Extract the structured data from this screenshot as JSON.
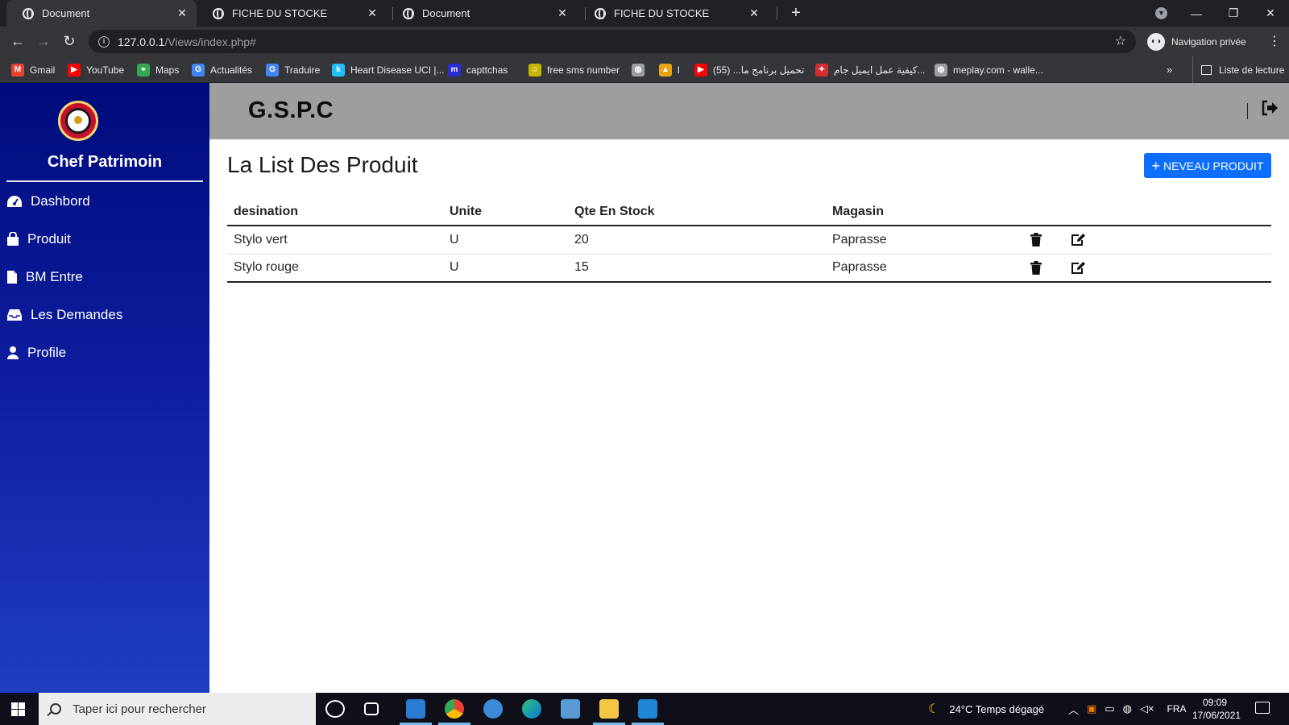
{
  "browser": {
    "tabs": [
      {
        "title": "Document",
        "active": true
      },
      {
        "title": "FICHE DU STOCKE",
        "active": false
      },
      {
        "title": "Document",
        "active": false
      },
      {
        "title": "FICHE DU STOCKE",
        "active": false
      }
    ],
    "url_host": "127.0.0.1",
    "url_path": "/Views/index.php#",
    "incognito_label": "Navigation privée",
    "bookmarks": [
      {
        "label": "Gmail",
        "icon": "gmail-icon",
        "color": "#ea4335",
        "glyph": "M"
      },
      {
        "label": "YouTube",
        "icon": "youtube-icon",
        "color": "#ff0000",
        "glyph": "▶"
      },
      {
        "label": "Maps",
        "icon": "maps-icon",
        "color": "#34a853",
        "glyph": "⌖"
      },
      {
        "label": "Actualités",
        "icon": "news-icon",
        "color": "#4285f4",
        "glyph": "G"
      },
      {
        "label": "Traduire",
        "icon": "translate-icon",
        "color": "#4285f4",
        "glyph": "G"
      },
      {
        "label": "Heart Disease UCI |...",
        "icon": "kaggle-icon",
        "color": "#20beff",
        "glyph": "k"
      },
      {
        "label": "capttchas",
        "icon": "m-icon",
        "color": "#2a2ad6",
        "glyph": "m"
      },
      {
        "label": "free sms number",
        "icon": "sms-icon",
        "color": "#c6b400",
        "glyph": "☺"
      },
      {
        "label": "",
        "icon": "globe-icon",
        "color": "#9aa0a6",
        "glyph": "◍"
      },
      {
        "label": "l",
        "icon": "site-icon",
        "color": "#e8a317",
        "glyph": "▲"
      },
      {
        "label": "تحميل برنامج ما... (55)",
        "icon": "youtube-icon",
        "color": "#ff0000",
        "glyph": "▶"
      },
      {
        "label": "كيفية عمل ايميل جام...",
        "icon": "site-icon",
        "color": "#d32f2f",
        "glyph": "✦"
      },
      {
        "label": "meplay.com - walle...",
        "icon": "globe-icon",
        "color": "#9aa0a6",
        "glyph": "◍"
      }
    ],
    "reading_list": "Liste de lecture"
  },
  "sidebar": {
    "role": "Chef Patrimoin",
    "items": [
      {
        "label": "Dashbord",
        "icon": "dashboard-icon"
      },
      {
        "label": "Produit",
        "icon": "bag-icon"
      },
      {
        "label": "BM Entre",
        "icon": "file-icon"
      },
      {
        "label": "Les Demandes",
        "icon": "inbox-icon"
      },
      {
        "label": "Profile",
        "icon": "user-icon"
      }
    ]
  },
  "header": {
    "brand": "G.S.P.C"
  },
  "main": {
    "title": "La List Des Produit",
    "new_button": "NEVEAU PRODUIT",
    "table": {
      "headers": [
        "desination",
        "Unite",
        "Qte En Stock",
        "Magasin"
      ],
      "rows": [
        {
          "desination": "Stylo vert",
          "unite": "U",
          "qte": "20",
          "magasin": "Paprasse"
        },
        {
          "desination": "Stylo rouge",
          "unite": "U",
          "qte": "15",
          "magasin": "Paprasse"
        }
      ]
    }
  },
  "taskbar": {
    "search_placeholder": "Taper ici pour rechercher",
    "weather": "24°C  Temps dégagé",
    "lang": "FRA",
    "time": "09:09",
    "date": "17/06/2021"
  }
}
